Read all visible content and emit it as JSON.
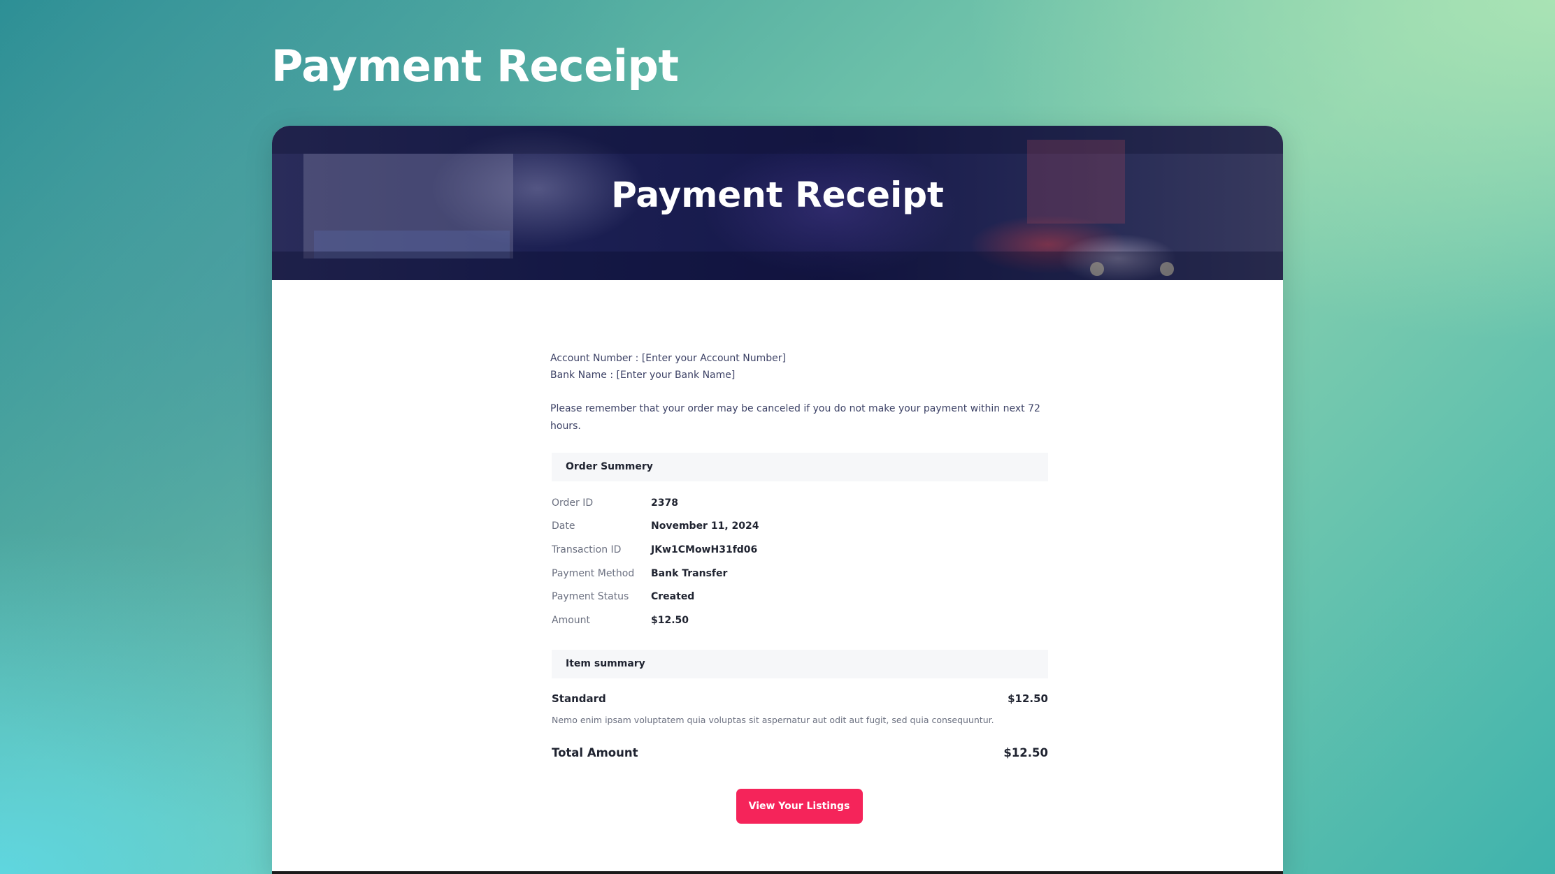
{
  "page": {
    "title": "Payment Receipt"
  },
  "hero": {
    "title": "Payment Receipt"
  },
  "payment_info": {
    "account_number": "Account Number : [Enter your Account Number]",
    "bank_name": "Bank Name : [Enter your Bank Name]",
    "notice": "Please remember that your order may be canceled if you do not make your payment within next 72 hours."
  },
  "order_summary": {
    "heading": "Order Summery",
    "rows": [
      {
        "label": "Order ID",
        "value": "2378"
      },
      {
        "label": "Date",
        "value": "November 11, 2024"
      },
      {
        "label": "Transaction ID",
        "value": "JKw1CMowH31fd06"
      },
      {
        "label": "Payment Method",
        "value": "Bank Transfer"
      },
      {
        "label": "Payment Status",
        "value": "Created"
      },
      {
        "label": "Amount",
        "value": "$12.50"
      }
    ]
  },
  "item_summary": {
    "heading": "Item summary",
    "item_name": "Standard",
    "item_price": "$12.50",
    "item_description": "Nemo enim ipsam voluptatem quia voluptas sit aspernatur aut odit aut fugit, sed quia consequuntur.",
    "total_label": "Total Amount",
    "total_value": "$12.50"
  },
  "actions": {
    "view_listings_label": "View Your Listings"
  },
  "colors": {
    "accent": "#f5245a",
    "section_bg": "#f6f7f9",
    "hero_bg": "#1b1f52"
  }
}
